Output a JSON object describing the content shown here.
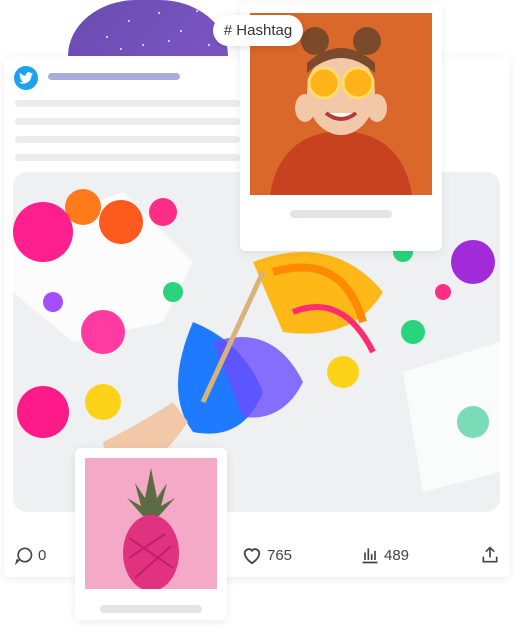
{
  "hashtag": {
    "label": "# Hashtag"
  },
  "stats": {
    "comments": "0",
    "likes": "765",
    "views": "489"
  },
  "icons": {
    "brand": "twitter-icon",
    "comment": "comment-icon",
    "like": "heart-icon",
    "views": "bar-chart-icon",
    "share": "share-icon"
  },
  "colors": {
    "twitter_blue": "#1da1f2",
    "accent_line": "#a8addb",
    "blob_purple": "#6a4bb0"
  }
}
